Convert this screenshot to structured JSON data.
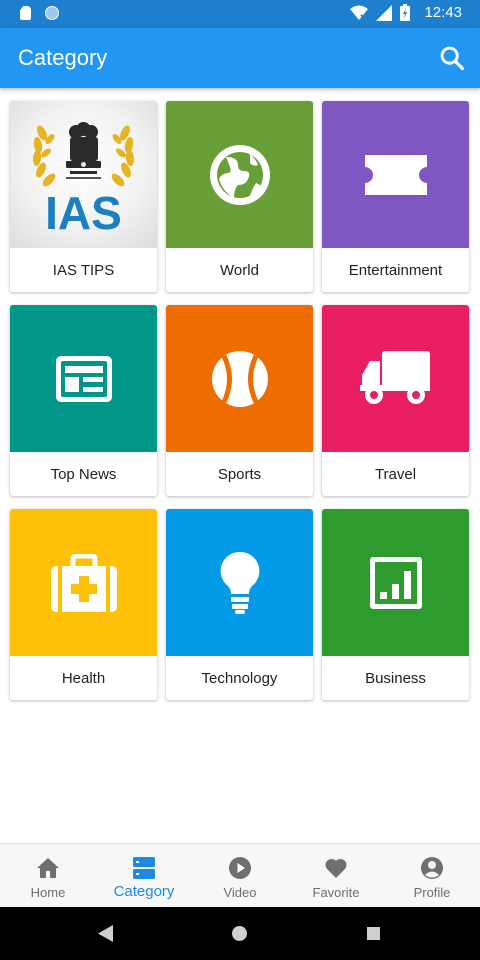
{
  "status_bar": {
    "time": "12:43"
  },
  "app_bar": {
    "title": "Category",
    "search_icon": "search-icon"
  },
  "categories": [
    {
      "label": "IAS TIPS",
      "color": "#ebebeb",
      "icon": "ias-emblem-logo",
      "logo_text": "IAS"
    },
    {
      "label": "World",
      "color": "#689f38",
      "icon": "globe-icon"
    },
    {
      "label": "Entertainment",
      "color": "#7e57c2",
      "icon": "ticket-icon"
    },
    {
      "label": "Top News",
      "color": "#00968a",
      "icon": "newspaper-icon"
    },
    {
      "label": "Sports",
      "color": "#ef6c00",
      "icon": "ball-icon"
    },
    {
      "label": "Travel",
      "color": "#e91e63",
      "icon": "truck-icon"
    },
    {
      "label": "Health",
      "color": "#ffc107",
      "icon": "medical-kit-icon"
    },
    {
      "label": "Technology",
      "color": "#039be5",
      "icon": "lightbulb-icon"
    },
    {
      "label": "Business",
      "color": "#2e9b2e",
      "icon": "bar-chart-icon"
    }
  ],
  "bottom_nav": {
    "active": "Category",
    "items": [
      {
        "label": "Home",
        "icon": "home-icon"
      },
      {
        "label": "Category",
        "icon": "category-icon"
      },
      {
        "label": "Video",
        "icon": "play-circle-icon"
      },
      {
        "label": "Favorite",
        "icon": "heart-icon"
      },
      {
        "label": "Profile",
        "icon": "account-circle-icon"
      }
    ]
  },
  "colors": {
    "status_bar": "#1f7fcf",
    "app_bar": "#2196f3",
    "active_nav": "#1e88e5",
    "inactive_nav": "#707070"
  }
}
